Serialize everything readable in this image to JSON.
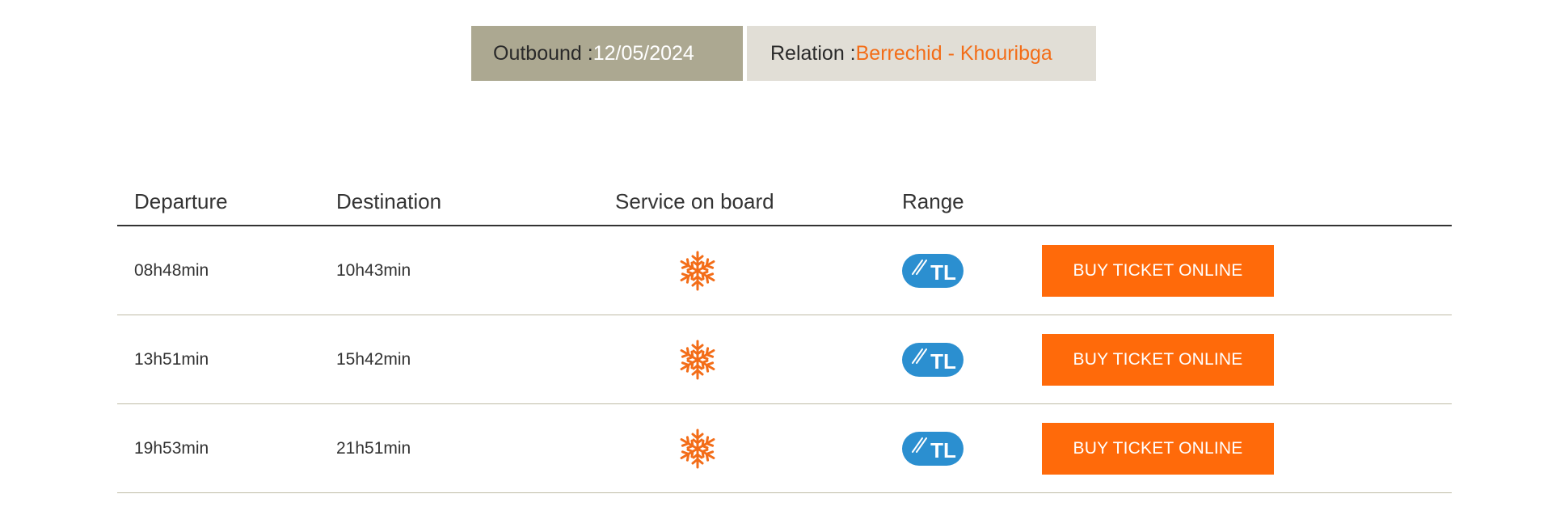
{
  "summary": {
    "outbound_label": "Outbound : ",
    "outbound_date": "12/05/2024",
    "relation_label": "Relation : ",
    "relation_value": "Berrechid - Khouribga"
  },
  "table": {
    "headers": {
      "departure": "Departure",
      "destination": "Destination",
      "service": "Service on board",
      "range": "Range"
    },
    "rows": [
      {
        "departure": "08h48min",
        "destination": "10h43min",
        "service_icon": "air-conditioning-icon",
        "range_badge": "TL",
        "buy_label": "BUY TICKET ONLINE"
      },
      {
        "departure": "13h51min",
        "destination": "15h42min",
        "service_icon": "air-conditioning-icon",
        "range_badge": "TL",
        "buy_label": "BUY TICKET ONLINE"
      },
      {
        "departure": "19h53min",
        "destination": "21h51min",
        "service_icon": "air-conditioning-icon",
        "range_badge": "TL",
        "buy_label": "BUY TICKET ONLINE"
      }
    ]
  },
  "colors": {
    "accent": "#ff6a0a",
    "relation_text": "#f36d18",
    "outbound_bg": "#aca891",
    "relation_bg": "#e1ded6",
    "badge": "#2b8fd0"
  }
}
